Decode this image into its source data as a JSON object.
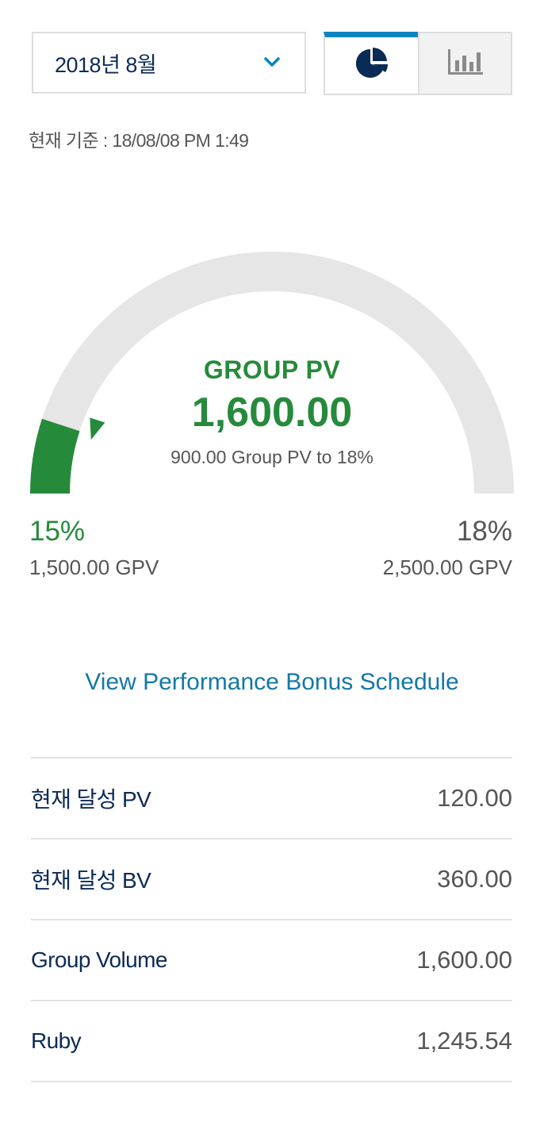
{
  "month_select": {
    "label": "2018년 8월",
    "icon": "chevron-down-icon"
  },
  "view_toggle": {
    "pie_icon": "pie-chart-icon",
    "bar_icon": "bar-chart-icon",
    "active": "pie",
    "accent_color": "#0a85c2"
  },
  "timestamp": "현재 기준 : 18/08/08 PM 1:49",
  "gauge": {
    "title": "GROUP PV",
    "value": "1,600.00",
    "subtitle": "900.00 Group PV to 18%",
    "min_percent": "15%",
    "min_gpv": "1,500.00 GPV",
    "max_percent": "18%",
    "max_gpv": "2,500.00 GPV",
    "progress_fraction": 0.1,
    "fill_color": "#268a3b",
    "track_color": "#e6e6e6"
  },
  "schedule_link": "View Performance Bonus Schedule",
  "stats": [
    {
      "label": "현재 달성 PV",
      "value": "120.00"
    },
    {
      "label": "현재 달성 BV",
      "value": "360.00"
    },
    {
      "label": "Group Volume",
      "value": "1,600.00"
    },
    {
      "label": "Ruby",
      "value": "1,245.54"
    }
  ]
}
